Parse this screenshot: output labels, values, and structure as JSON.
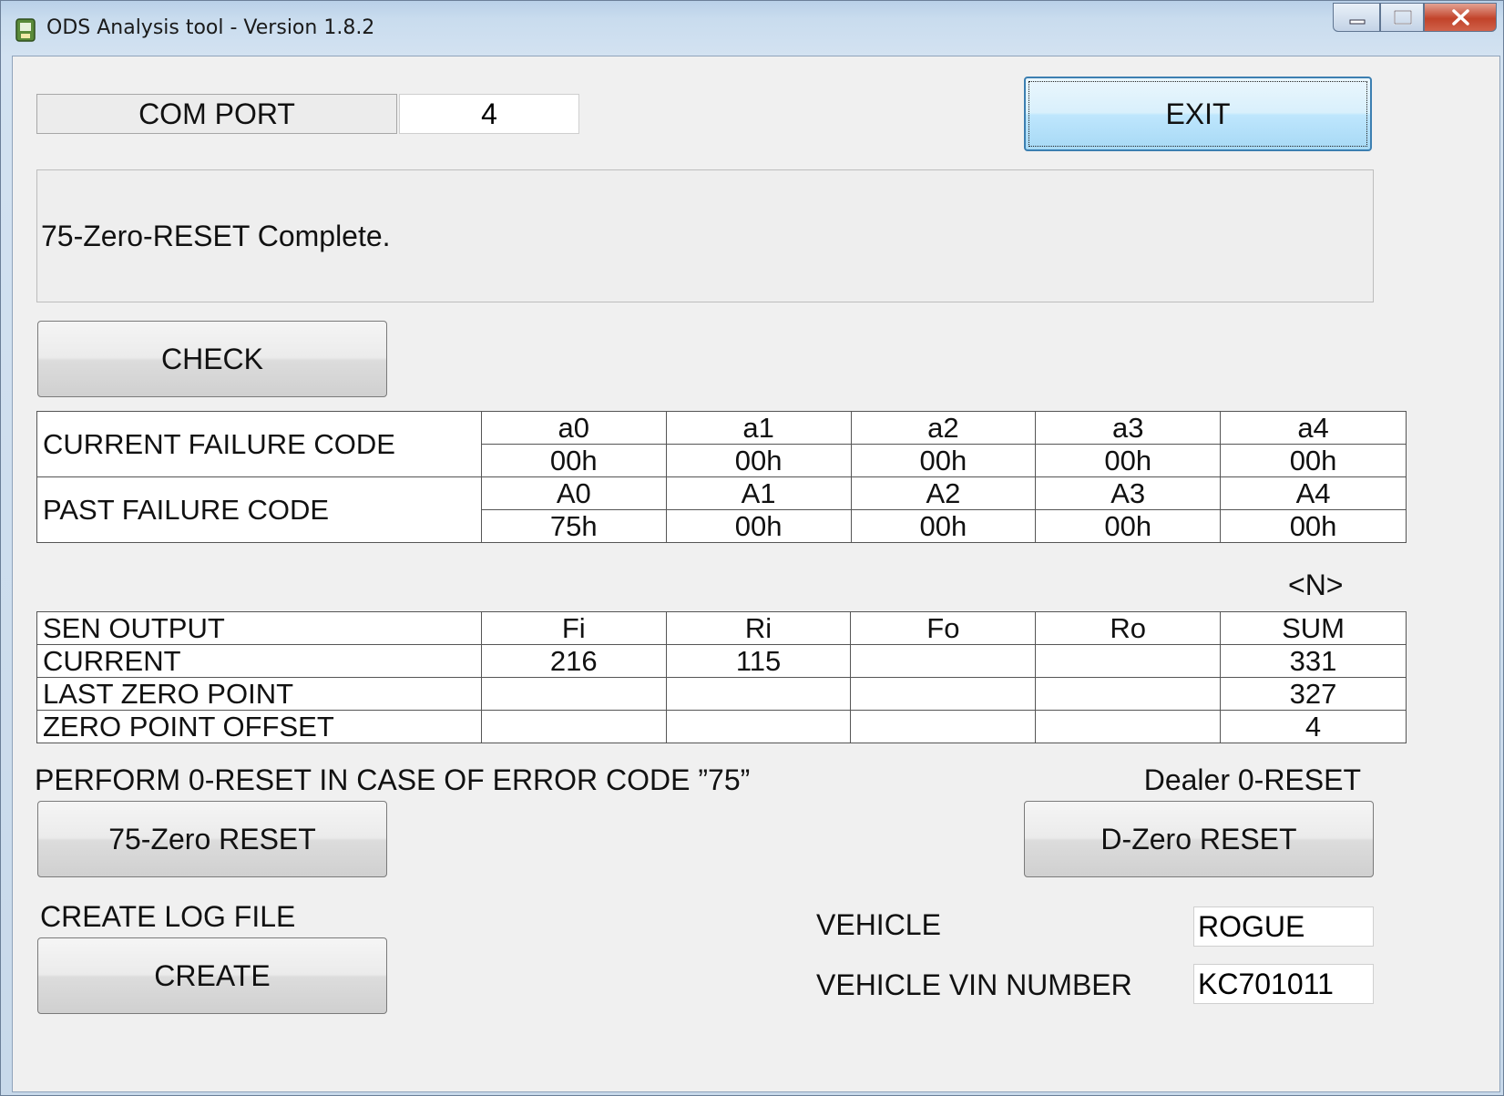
{
  "window": {
    "title": "ODS Analysis tool - Version 1.8.2"
  },
  "com_port": {
    "label": "COM PORT",
    "value": "4"
  },
  "buttons": {
    "exit": "EXIT",
    "check": "CHECK",
    "zero75": "75-Zero RESET",
    "dzero": "D-Zero RESET",
    "create": "CREATE"
  },
  "status_message": "75-Zero-RESET Complete.",
  "failure_codes": {
    "current_label": "CURRENT FAILURE CODE",
    "past_label": "PAST FAILURE CODE",
    "current_headers": [
      "a0",
      "a1",
      "a2",
      "a3",
      "a4"
    ],
    "current_values": [
      "00h",
      "00h",
      "00h",
      "00h",
      "00h"
    ],
    "past_headers": [
      "A0",
      "A1",
      "A2",
      "A3",
      "A4"
    ],
    "past_values": [
      "75h",
      "00h",
      "00h",
      "00h",
      "00h"
    ]
  },
  "sensor": {
    "unit": "<N>",
    "header": [
      "SEN OUTPUT",
      "Fi",
      "Ri",
      "Fo",
      "Ro",
      "SUM"
    ],
    "rows": [
      [
        "CURRENT",
        "216",
        "115",
        "",
        "",
        "331"
      ],
      [
        "LAST ZERO POINT",
        "",
        "",
        "",
        "",
        "327"
      ],
      [
        "ZERO POINT OFFSET",
        "",
        "",
        "",
        "",
        "4"
      ]
    ]
  },
  "instructions": {
    "perform_reset": "PERFORM 0-RESET IN CASE OF ERROR CODE ”75”",
    "dealer_reset": "Dealer 0-RESET",
    "create_log": "CREATE LOG FILE"
  },
  "vehicle": {
    "vehicle_label": "VEHICLE",
    "vehicle_value": "ROGUE",
    "vin_label": "VEHICLE VIN NUMBER",
    "vin_value": "KC701011"
  }
}
